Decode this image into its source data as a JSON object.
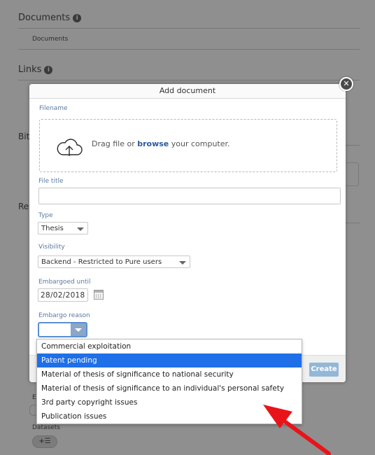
{
  "background": {
    "documents_title": "Documents",
    "documents_sub": "Documents",
    "links_title": "Links",
    "bib_fragment": "Bit",
    "re_fragment": "Re",
    "e_fragment": "E",
    "datasets_label": "Datasets",
    "add_pill": "+☰"
  },
  "modal": {
    "title": "Add document",
    "filename_label": "Filename",
    "drop_prefix": "Drag file or ",
    "drop_link": "browse",
    "drop_suffix": " your computer.",
    "file_title_label": "File title",
    "file_title_value": "",
    "type_label": "Type",
    "type_value": "Thesis",
    "visibility_label": "Visibility",
    "visibility_value": "Backend - Restricted to Pure users",
    "embargoed_label": "Embargoed until",
    "embargoed_value": "28/02/2018",
    "embargo_reason_label": "Embargo reason",
    "create_label": "Create"
  },
  "embargo_options": [
    "Commercial exploitation",
    "Patent pending",
    "Material of thesis of significance to national security",
    "Material of thesis of significance to an individual's personal safety",
    "3rd party copyright issues",
    "Publication issues"
  ],
  "selected_option_index": 1,
  "colors": {
    "selected_option": "#1e6fe8",
    "link": "#2b5a99",
    "annotation_arrow": "#e8141a"
  },
  "icons": {
    "close": "close-icon",
    "upload": "cloud-upload-icon",
    "calendar": "calendar-icon",
    "info": "info-icon"
  }
}
